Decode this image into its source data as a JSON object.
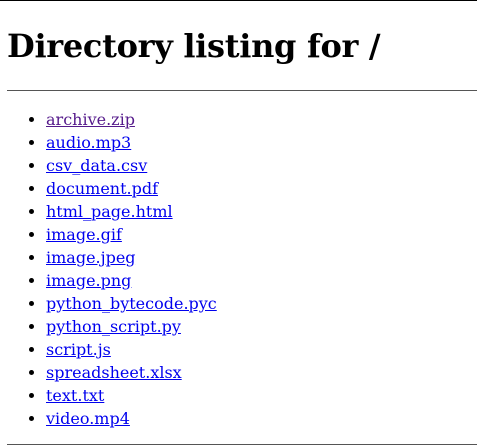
{
  "page": {
    "heading": "Directory listing for /"
  },
  "files": [
    {
      "name": "archive.zip",
      "visited": true
    },
    {
      "name": "audio.mp3",
      "visited": false
    },
    {
      "name": "csv_data.csv",
      "visited": false
    },
    {
      "name": "document.pdf",
      "visited": false
    },
    {
      "name": "html_page.html",
      "visited": false
    },
    {
      "name": "image.gif",
      "visited": false
    },
    {
      "name": "image.jpeg",
      "visited": false
    },
    {
      "name": "image.png",
      "visited": false
    },
    {
      "name": "python_bytecode.pyc",
      "visited": false
    },
    {
      "name": "python_script.py",
      "visited": false
    },
    {
      "name": "script.js",
      "visited": false
    },
    {
      "name": "spreadsheet.xlsx",
      "visited": false
    },
    {
      "name": "text.txt",
      "visited": false
    },
    {
      "name": "video.mp4",
      "visited": false
    }
  ],
  "colors": {
    "link": "#0000ee",
    "visited_link": "#551a8b",
    "rule": "#555555"
  }
}
